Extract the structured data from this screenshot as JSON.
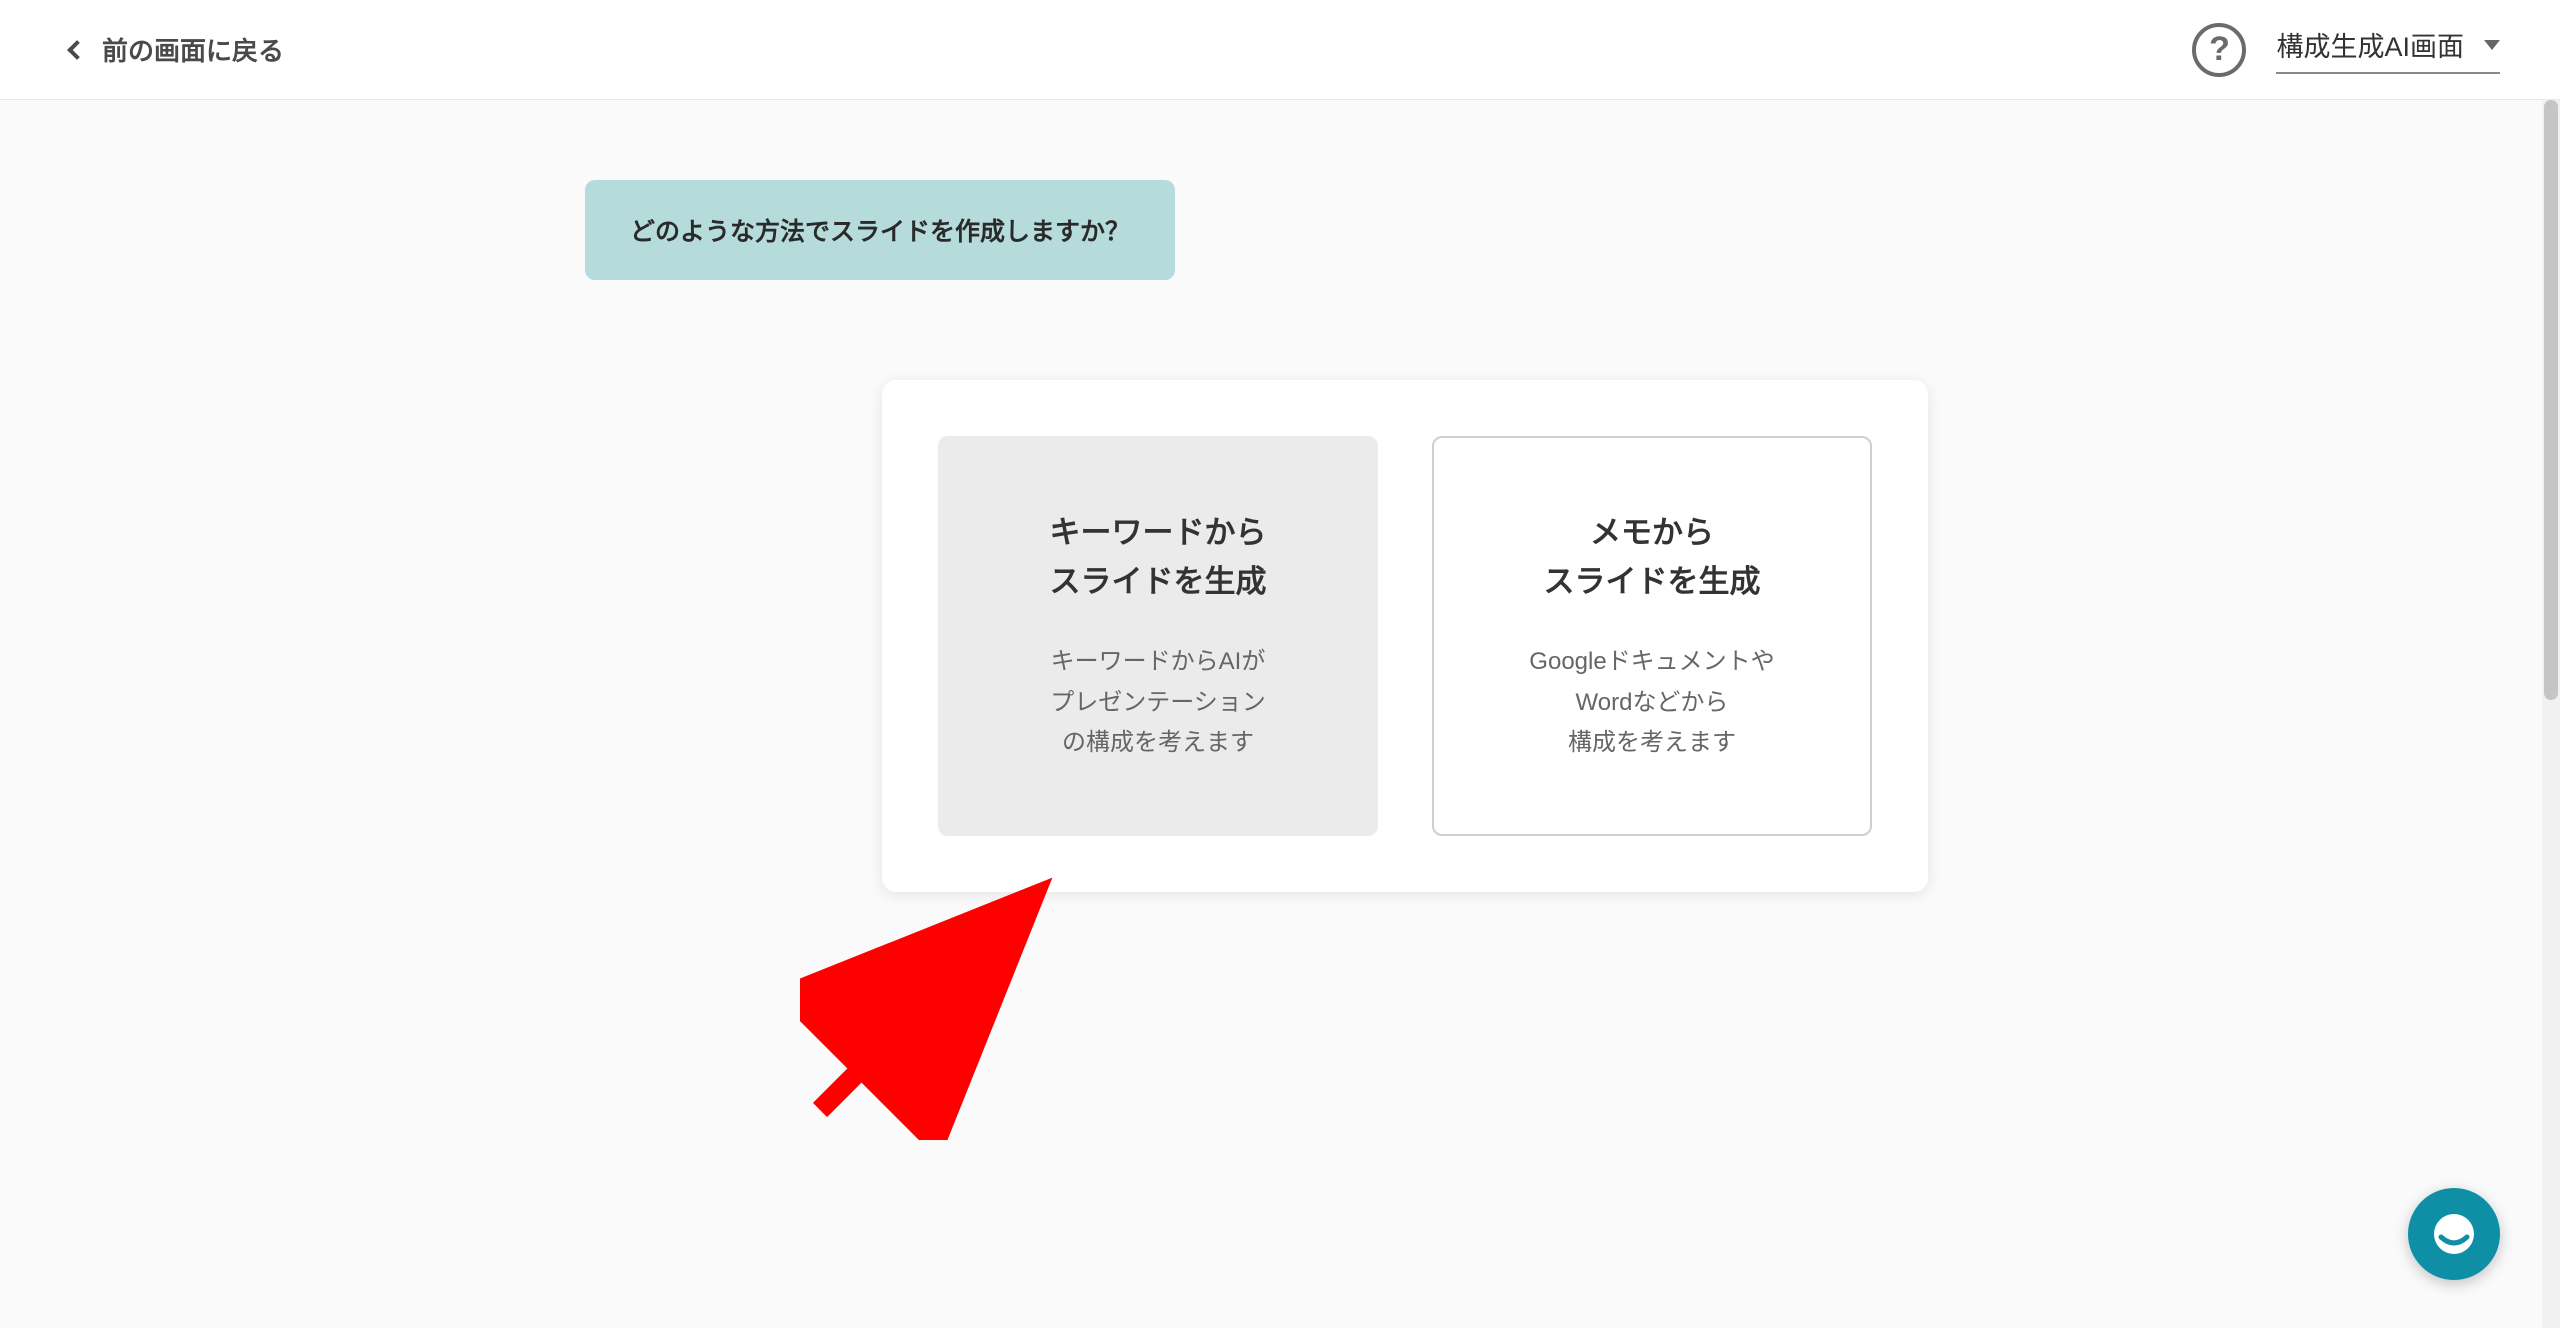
{
  "header": {
    "back_label": "前の画面に戻る",
    "help_symbol": "?",
    "screen_selector_label": "構成生成AI画面"
  },
  "prompt": {
    "text": "どのような方法でスライドを作成しますか？"
  },
  "options": [
    {
      "title_line1": "キーワードから",
      "title_line2": "スライドを生成",
      "desc_line1": "キーワードからAIが",
      "desc_line2": "プレゼンテーション",
      "desc_line3": "の構成を考えます"
    },
    {
      "title_line1": "メモから",
      "title_line2": "スライドを生成",
      "desc_line1": "Googleドキュメントや",
      "desc_line2": "Wordなどから",
      "desc_line3": "構成を考えます"
    }
  ]
}
